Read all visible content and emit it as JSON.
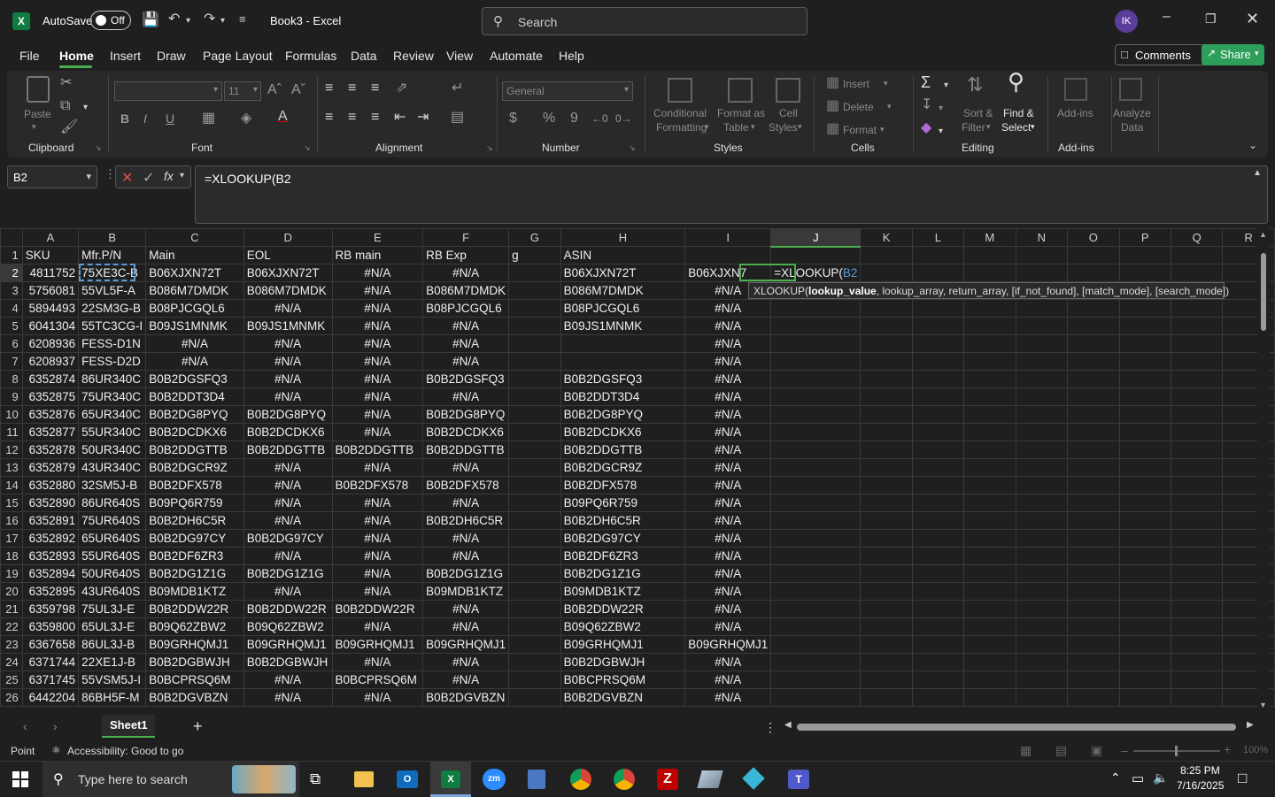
{
  "app": {
    "autosave_label": "AutoSave",
    "autosave_state": "Off",
    "title": "Book3 - Excel",
    "search_placeholder": "Search",
    "user_initials": "IK"
  },
  "tabs": [
    "File",
    "Home",
    "Insert",
    "Draw",
    "Page Layout",
    "Formulas",
    "Data",
    "Review",
    "View",
    "Automate",
    "Help"
  ],
  "comments_label": "Comments",
  "share_label": "Share",
  "ribbon": {
    "clipboard": {
      "paste": "Paste",
      "group": "Clipboard"
    },
    "font": {
      "size": "11",
      "group": "Font"
    },
    "alignment": {
      "group": "Alignment"
    },
    "number": {
      "format": "General",
      "group": "Number",
      "currency": "$",
      "percent": "%",
      "comma": "9"
    },
    "styles": {
      "conditional": "Conditional",
      "formatting": "Formatting",
      "format_as": "Format as",
      "table": "Table",
      "cell": "Cell",
      "styles": "Styles",
      "group": "Styles"
    },
    "cells": {
      "insert": "Insert",
      "delete": "Delete",
      "format": "Format",
      "group": "Cells"
    },
    "editing": {
      "sort": "Sort &",
      "filter": "Filter",
      "find": "Find &",
      "select": "Select",
      "group": "Editing"
    },
    "addins": {
      "label": "Add-ins",
      "group": "Add-ins"
    },
    "analyze": {
      "l1": "Analyze",
      "l2": "Data"
    }
  },
  "formula": {
    "namebox": "B2",
    "content": "=XLOOKUP(B2"
  },
  "columns": [
    "A",
    "B",
    "C",
    "D",
    "E",
    "F",
    "G",
    "H",
    "I",
    "J",
    "K",
    "L",
    "M",
    "N",
    "O",
    "P",
    "Q",
    "R"
  ],
  "rows": [
    [
      "SKU",
      "Mfr.P/N",
      "Main",
      "EOL",
      "RB main",
      "RB Exp",
      "g",
      "ASIN",
      "",
      ""
    ],
    [
      "4811752",
      "75XE3C-B",
      "B06XJXN72T",
      "B06XJXN72T",
      "#N/A",
      "#N/A",
      "",
      "B06XJXN72T",
      "B06XJXN7",
      "=XLOOKUP(B2"
    ],
    [
      "5756081",
      "55VL5F-A",
      "B086M7DMDK",
      "B086M7DMDK",
      "#N/A",
      "B086M7DMDK",
      "",
      "B086M7DMDK",
      "#N/A",
      ""
    ],
    [
      "5894493",
      "22SM3G-B",
      "B08PJCGQL6",
      "#N/A",
      "#N/A",
      "B08PJCGQL6",
      "",
      "B08PJCGQL6",
      "#N/A",
      ""
    ],
    [
      "6041304",
      "55TC3CG-I",
      "B09JS1MNMK",
      "B09JS1MNMK",
      "#N/A",
      "#N/A",
      "",
      "B09JS1MNMK",
      "#N/A",
      ""
    ],
    [
      "6208936",
      "FESS-D1N",
      "#N/A",
      "#N/A",
      "#N/A",
      "#N/A",
      "",
      "",
      "#N/A",
      ""
    ],
    [
      "6208937",
      "FESS-D2D",
      "#N/A",
      "#N/A",
      "#N/A",
      "#N/A",
      "",
      "",
      "#N/A",
      ""
    ],
    [
      "6352874",
      "86UR340C",
      "B0B2DGSFQ3",
      "#N/A",
      "#N/A",
      "B0B2DGSFQ3",
      "",
      "B0B2DGSFQ3",
      "#N/A",
      ""
    ],
    [
      "6352875",
      "75UR340C",
      "B0B2DDT3D4",
      "#N/A",
      "#N/A",
      "#N/A",
      "",
      "B0B2DDT3D4",
      "#N/A",
      ""
    ],
    [
      "6352876",
      "65UR340C",
      "B0B2DG8PYQ",
      "B0B2DG8PYQ",
      "#N/A",
      "B0B2DG8PYQ",
      "",
      "B0B2DG8PYQ",
      "#N/A",
      ""
    ],
    [
      "6352877",
      "55UR340C",
      "B0B2DCDKX6",
      "B0B2DCDKX6",
      "#N/A",
      "B0B2DCDKX6",
      "",
      "B0B2DCDKX6",
      "#N/A",
      ""
    ],
    [
      "6352878",
      "50UR340C",
      "B0B2DDGTTB",
      "B0B2DDGTTB",
      "B0B2DDGTTB",
      "B0B2DDGTTB",
      "",
      "B0B2DDGTTB",
      "#N/A",
      ""
    ],
    [
      "6352879",
      "43UR340C",
      "B0B2DGCR9Z",
      "#N/A",
      "#N/A",
      "#N/A",
      "",
      "B0B2DGCR9Z",
      "#N/A",
      ""
    ],
    [
      "6352880",
      "32SM5J-B",
      "B0B2DFX578",
      "#N/A",
      "B0B2DFX578",
      "B0B2DFX578",
      "",
      "B0B2DFX578",
      "#N/A",
      ""
    ],
    [
      "6352890",
      "86UR640S",
      "B09PQ6R759",
      "#N/A",
      "#N/A",
      "#N/A",
      "",
      "B09PQ6R759",
      "#N/A",
      ""
    ],
    [
      "6352891",
      "75UR640S",
      "B0B2DH6C5R",
      "#N/A",
      "#N/A",
      "B0B2DH6C5R",
      "",
      "B0B2DH6C5R",
      "#N/A",
      ""
    ],
    [
      "6352892",
      "65UR640S",
      "B0B2DG97CY",
      "B0B2DG97CY",
      "#N/A",
      "#N/A",
      "",
      "B0B2DG97CY",
      "#N/A",
      ""
    ],
    [
      "6352893",
      "55UR640S",
      "B0B2DF6ZR3",
      "#N/A",
      "#N/A",
      "#N/A",
      "",
      "B0B2DF6ZR3",
      "#N/A",
      ""
    ],
    [
      "6352894",
      "50UR640S",
      "B0B2DG1Z1G",
      "B0B2DG1Z1G",
      "#N/A",
      "B0B2DG1Z1G",
      "",
      "B0B2DG1Z1G",
      "#N/A",
      ""
    ],
    [
      "6352895",
      "43UR640S",
      "B09MDB1KTZ",
      "#N/A",
      "#N/A",
      "B09MDB1KTZ",
      "",
      "B09MDB1KTZ",
      "#N/A",
      ""
    ],
    [
      "6359798",
      "75UL3J-E",
      "B0B2DDW22R",
      "B0B2DDW22R",
      "B0B2DDW22R",
      "#N/A",
      "",
      "B0B2DDW22R",
      "#N/A",
      ""
    ],
    [
      "6359800",
      "65UL3J-E",
      "B09Q62ZBW2",
      "B09Q62ZBW2",
      "#N/A",
      "#N/A",
      "",
      "B09Q62ZBW2",
      "#N/A",
      ""
    ],
    [
      "6367658",
      "86UL3J-B",
      "B09GRHQMJ1",
      "B09GRHQMJ1",
      "B09GRHQMJ1",
      "B09GRHQMJ1",
      "",
      "B09GRHQMJ1",
      "B09GRHQMJ1",
      ""
    ],
    [
      "6371744",
      "22XE1J-B",
      "B0B2DGBWJH",
      "B0B2DGBWJH",
      "#N/A",
      "#N/A",
      "",
      "B0B2DGBWJH",
      "#N/A",
      ""
    ],
    [
      "6371745",
      "55VSM5J-I",
      "B0BCPRSQ6M",
      "#N/A",
      "B0BCPRSQ6M",
      "#N/A",
      "",
      "B0BCPRSQ6M",
      "#N/A",
      ""
    ],
    [
      "6442204",
      "86BH5F-M",
      "B0B2DGVBZN",
      "#N/A",
      "#N/A",
      "B0B2DGVBZN",
      "",
      "B0B2DGVBZN",
      "#N/A",
      ""
    ]
  ],
  "tooltip": {
    "fn": "XLOOKUP(",
    "arg1": "lookup_value",
    "rest": ", lookup_array, return_array, [if_not_found], [match_mode], [search_mode])"
  },
  "sheet": {
    "name": "Sheet1"
  },
  "status": {
    "mode": "Point",
    "accessibility": "Accessibility: Good to go",
    "zoom": "100%"
  },
  "taskbar": {
    "search_placeholder": "Type here to search",
    "time": "8:25 PM",
    "date": "7/16/2025"
  }
}
